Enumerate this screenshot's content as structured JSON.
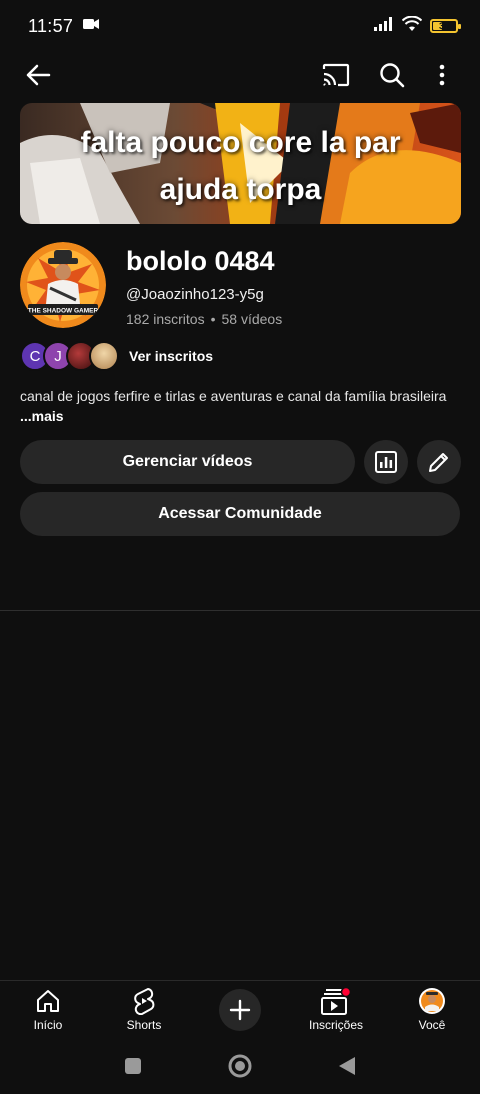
{
  "status_bar": {
    "time": "11:57",
    "battery_level": "37",
    "icons": [
      "video-record-icon",
      "signal-icon",
      "wifi-icon",
      "battery-icon"
    ]
  },
  "app_bar": {
    "icons": [
      "back-arrow-icon",
      "cast-icon",
      "search-icon",
      "more-vert-icon"
    ]
  },
  "banner": {
    "line1": "falta pouco core la par",
    "line2": "ajuda torpa"
  },
  "channel": {
    "name": "bololo 0484",
    "handle": "@Joaozinho123-y5g",
    "subscribers": "182 inscritos",
    "separator": "•",
    "videos": "58 vídeos",
    "avatar_text": "THE SHADOW GAMER"
  },
  "subscribers_row": {
    "avatars": [
      {
        "letter": "C",
        "color": "#5e35b1"
      },
      {
        "letter": "J",
        "color": "#8e44ad"
      },
      {
        "letter": "",
        "color": "#7b1e1e"
      },
      {
        "letter": "",
        "color": "#d9b88f"
      }
    ],
    "label": "Ver inscritos"
  },
  "description": {
    "text": "canal de jogos ferfire e tirlas e aventuras e canal da família brasileira",
    "more": "...mais"
  },
  "actions": {
    "manage_videos": "Gerenciar vídeos",
    "community": "Acessar Comunidade"
  },
  "bottom_nav": {
    "items": [
      {
        "label": "Início",
        "icon": "home-icon"
      },
      {
        "label": "Shorts",
        "icon": "shorts-icon"
      },
      {
        "label": "",
        "icon": "create-plus-icon"
      },
      {
        "label": "Inscrições",
        "icon": "subscriptions-icon"
      },
      {
        "label": "Você",
        "icon": "profile-avatar-icon"
      }
    ]
  },
  "colors": {
    "background": "#0f0f0f",
    "surface": "#272727",
    "notification_dot": "#ff0033",
    "battery": "#f4c430"
  }
}
